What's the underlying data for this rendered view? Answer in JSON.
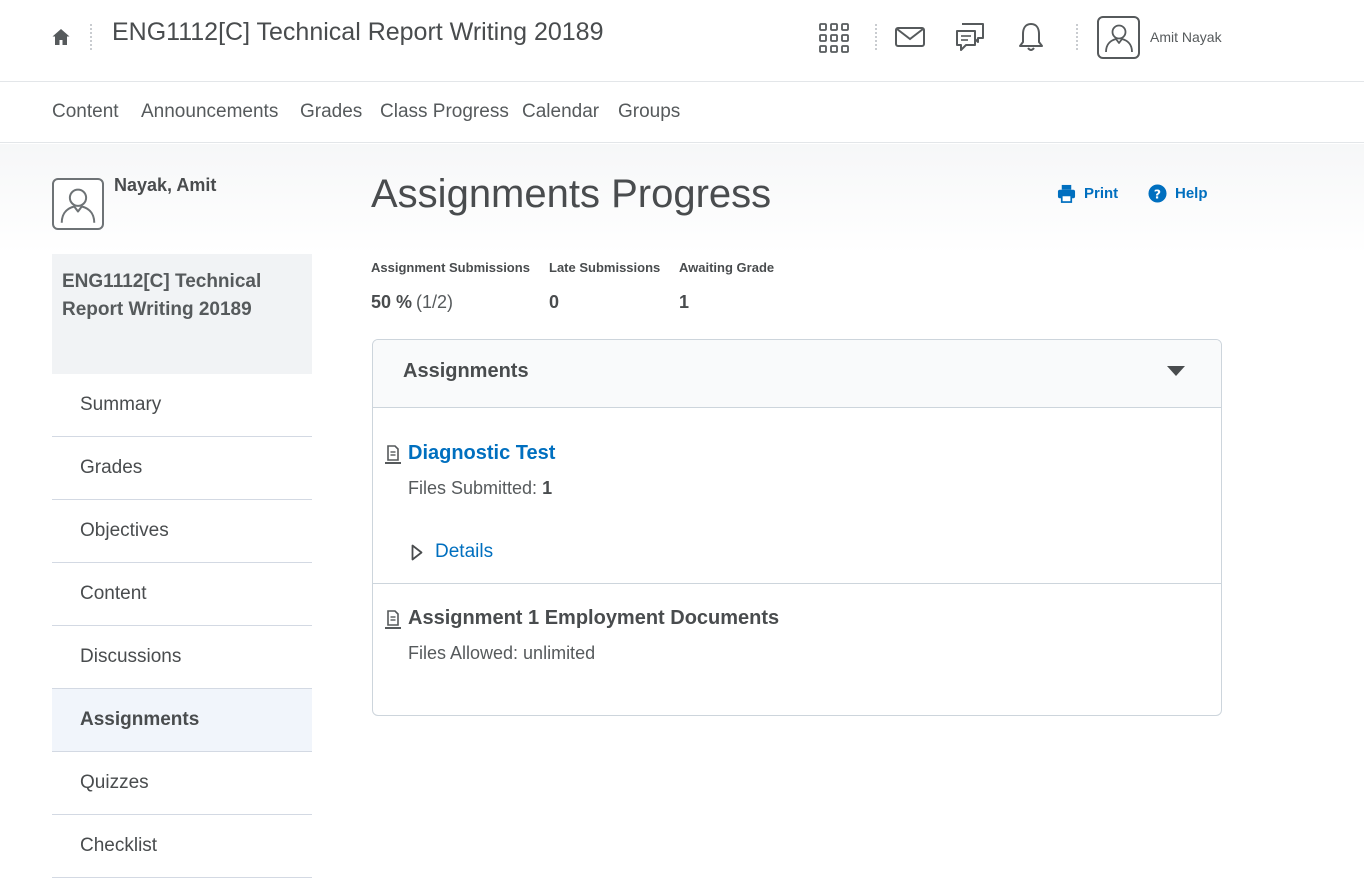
{
  "header": {
    "course_title": "ENG1112[C] Technical Report Writing 20189",
    "user_name": "Amit Nayak",
    "icons": [
      "home-icon",
      "waffle-grid-icon",
      "mail-icon",
      "chat-icon",
      "bell-icon",
      "user-avatar-icon"
    ]
  },
  "nav": {
    "items": [
      "Content",
      "Announcements",
      "Grades",
      "Class Progress",
      "Calendar",
      "Groups"
    ]
  },
  "sidebar": {
    "profile_name": "Nayak, Amit",
    "course_name": "ENG1112[C] Technical Report Writing 20189",
    "items": [
      {
        "label": "Summary",
        "active": false
      },
      {
        "label": "Grades",
        "active": false
      },
      {
        "label": "Objectives",
        "active": false
      },
      {
        "label": "Content",
        "active": false
      },
      {
        "label": "Discussions",
        "active": false
      },
      {
        "label": "Assignments",
        "active": true
      },
      {
        "label": "Quizzes",
        "active": false
      },
      {
        "label": "Checklist",
        "active": false
      }
    ]
  },
  "main": {
    "title": "Assignments Progress",
    "print_label": "Print",
    "help_label": "Help",
    "stats": [
      {
        "label": "Assignment Submissions",
        "value": "50 %",
        "extra": "(1/2)"
      },
      {
        "label": "Late Submissions",
        "value": "0"
      },
      {
        "label": "Awaiting Grade",
        "value": "1"
      }
    ],
    "panel": {
      "title": "Assignments",
      "assignments": [
        {
          "title": "Diagnostic Test",
          "sub_label": "Files Submitted:",
          "sub_value": "1",
          "details_label": "Details"
        },
        {
          "title": "Assignment 1 Employment Documents",
          "sub_label": "Files Allowed: unlimited"
        }
      ]
    }
  },
  "colors": {
    "link": "#006fbf",
    "text": "#494c4e",
    "active_bg": "#f1f5fb"
  }
}
